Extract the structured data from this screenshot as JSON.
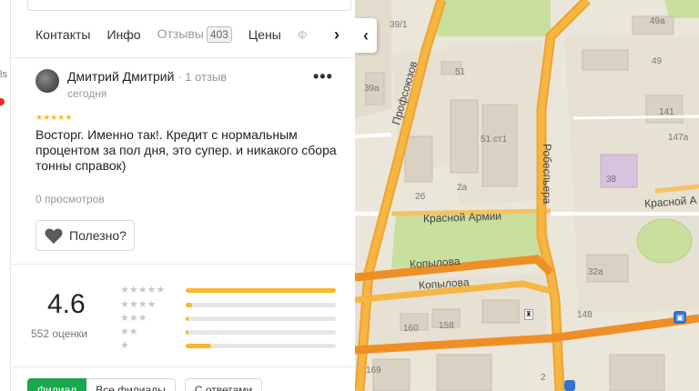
{
  "tabs": {
    "items": [
      "Контакты",
      "Инфо",
      "Отзывы",
      "Цены",
      "Ф"
    ],
    "reviews_count": "403",
    "next_icon": "chevron-right-icon"
  },
  "review": {
    "author": "Дмитрий Дмитрий",
    "author_reviews": "1 отзыв",
    "date": "сегодня",
    "rating": 5,
    "stars": "★★★★★",
    "text": "Восторг. Именно так!. Кредит с нормальным процентом за пол дня, это супер. и никакого сбора тонны справок)",
    "views": "0 просмотров",
    "useful_label": "Полезно?",
    "more_label": "•••"
  },
  "rating_summary": {
    "score": "4.6",
    "count_label": "552 оценки",
    "distribution": [
      {
        "stars": "★★★★★",
        "fraction": 1.0
      },
      {
        "stars": "★★★★",
        "fraction": 0.04
      },
      {
        "stars": "★★★",
        "fraction": 0.02
      },
      {
        "stars": "★★",
        "fraction": 0.02
      },
      {
        "stars": "★",
        "fraction": 0.17
      }
    ],
    "color": "#f7b928"
  },
  "filters": {
    "items": [
      "Филиал",
      "Все филиалы",
      "С ответами"
    ],
    "active_color": "#19a84d"
  },
  "left_edge": {
    "text": "ls"
  },
  "map": {
    "collapse_icon": "chevron-left-icon",
    "streets": [
      "Профсоюзов",
      "Робеспьера",
      "Красной Армии",
      "Красной А",
      "Копылова",
      "Копылова"
    ],
    "buildings": [
      "39/1",
      "49а",
      "51",
      "49",
      "39а",
      "141",
      "51 ст1",
      "147а",
      "2б",
      "2а",
      "38",
      "32а",
      "160",
      "158",
      "148",
      "169",
      "2"
    ]
  }
}
